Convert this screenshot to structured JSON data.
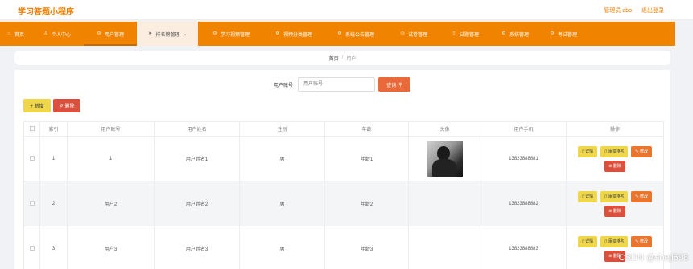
{
  "header": {
    "title": "学习答题小程序",
    "user_label": "管理员 abo",
    "logout_label": "退出登录"
  },
  "nav": [
    {
      "label": "首页",
      "icon": "home-icon",
      "glyph": "⌂"
    },
    {
      "label": "个人中心",
      "icon": "person-icon",
      "glyph": "♙"
    },
    {
      "label": "用户管理",
      "icon": "gear-icon",
      "glyph": "⚙"
    },
    {
      "label": "排名榜管理",
      "icon": "send-icon",
      "glyph": "➤"
    },
    {
      "label": "学习视频管理",
      "icon": "gear-icon",
      "glyph": "⚙"
    },
    {
      "label": "视频分类管理",
      "icon": "gear-icon",
      "glyph": "⚙"
    },
    {
      "label": "系统公告管理",
      "icon": "gear-icon",
      "glyph": "⚙"
    },
    {
      "label": "试卷管理",
      "icon": "clock-icon",
      "glyph": "◷"
    },
    {
      "label": "试题管理",
      "icon": "doc-icon",
      "glyph": "▯"
    },
    {
      "label": "系统管理",
      "icon": "gear-icon",
      "glyph": "⚙"
    },
    {
      "label": "考试管理",
      "icon": "gear-icon",
      "glyph": "⚙"
    }
  ],
  "breadcrumb": {
    "home": "首页",
    "separator": "/",
    "current": "用户"
  },
  "search": {
    "label": "用户账号",
    "placeholder": "用户账号",
    "button_label": "查询"
  },
  "toolbar": {
    "add_label": "+ 新增",
    "delete_label": "删除"
  },
  "table": {
    "columns": [
      "索引",
      "用户账号",
      "用户姓名",
      "性别",
      "年龄",
      "头像",
      "用户手机",
      "操作"
    ],
    "rows": [
      {
        "index": "1",
        "account": "1",
        "name": "用户姓名1",
        "gender": "男",
        "age": "年龄1",
        "phone": "13823888881",
        "has_avatar": true
      },
      {
        "index": "2",
        "account": "用户2",
        "name": "用户姓名2",
        "gender": "男",
        "age": "年龄2",
        "phone": "13823888882",
        "has_avatar": false
      },
      {
        "index": "3",
        "account": "用户3",
        "name": "用户姓名3",
        "gender": "男",
        "age": "年龄3",
        "phone": "13823888883",
        "has_avatar": false
      }
    ],
    "actions": {
      "detail": "详情",
      "rank": "添加排名",
      "edit": "修改",
      "remove": "删除"
    }
  },
  "watermark": "CSDN @sheji508",
  "colors": {
    "accent": "#f08300",
    "danger": "#d9503c",
    "warning": "#efd64b"
  }
}
